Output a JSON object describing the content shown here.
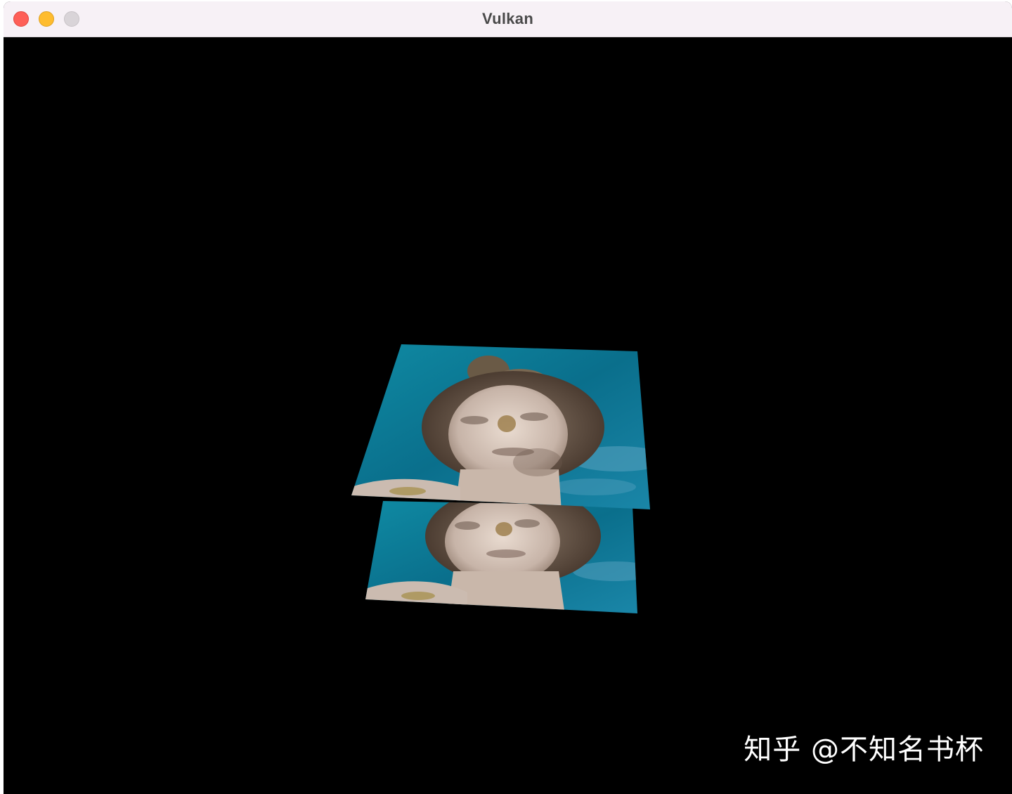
{
  "window": {
    "title": "Vulkan",
    "buttons": {
      "close_color": "#fe5f57",
      "minimize_color": "#febc2e",
      "zoom_color": "#d9d4d8"
    }
  },
  "canvas": {
    "background": "#000000",
    "content": "two textured quads showing a statue head photograph over blue sky",
    "quads": [
      {
        "name": "textured-quad-front",
        "colors": [
          "#0b7e98",
          "#0f5f7a",
          "#d8c8bd",
          "#6a5540"
        ]
      },
      {
        "name": "textured-quad-back",
        "colors": [
          "#0b7e98",
          "#0f5f7a",
          "#d8c8bd",
          "#6a5540"
        ]
      }
    ]
  },
  "watermark": {
    "text": "知乎 @不知名书杯"
  }
}
